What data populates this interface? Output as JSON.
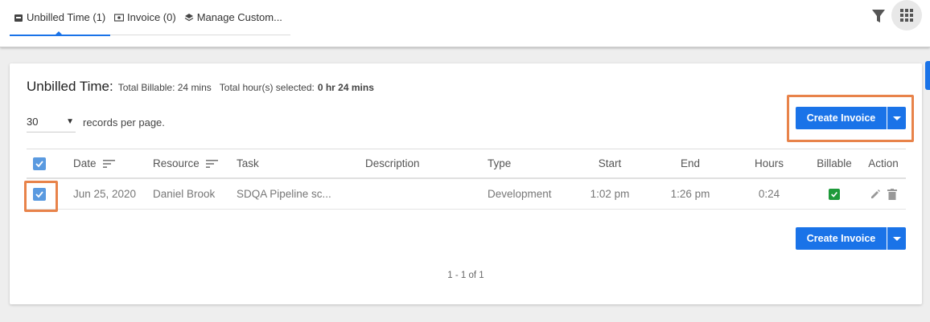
{
  "tabs": [
    {
      "label": "Unbilled Time (1)",
      "icon": "wallet-icon"
    },
    {
      "label": "Invoice (0)",
      "icon": "invoice-icon"
    },
    {
      "label": "Manage Custom...",
      "icon": "layers-icon"
    }
  ],
  "toolbar": {
    "filter_icon": "filter-icon",
    "apps_icon": "grid-apps-icon"
  },
  "summary": {
    "title": "Unbilled Time:",
    "billable_label": "Total Billable: 24 mins",
    "selected_label": "Total hour(s) selected:",
    "selected_value": "0 hr 24 mins"
  },
  "pager": {
    "per_page_value": "30",
    "per_page_label": "records per page."
  },
  "actions": {
    "create_invoice": "Create Invoice"
  },
  "table": {
    "columns": [
      "Date",
      "Resource",
      "Task",
      "Description",
      "Type",
      "Start",
      "End",
      "Hours",
      "Billable",
      "Action"
    ],
    "rows": [
      {
        "date": "Jun 25, 2020",
        "resource": "Daniel Brook",
        "task": "SDQA Pipeline sc...",
        "description": "",
        "type": "Development",
        "start": "1:02 pm",
        "end": "1:26 pm",
        "hours": "0:24",
        "billable": true
      }
    ]
  },
  "pagination": {
    "text": "1 - 1 of 1"
  },
  "colors": {
    "accent": "#1a73e8",
    "highlight": "#e8834a",
    "billable_green": "#1e9a3a"
  }
}
